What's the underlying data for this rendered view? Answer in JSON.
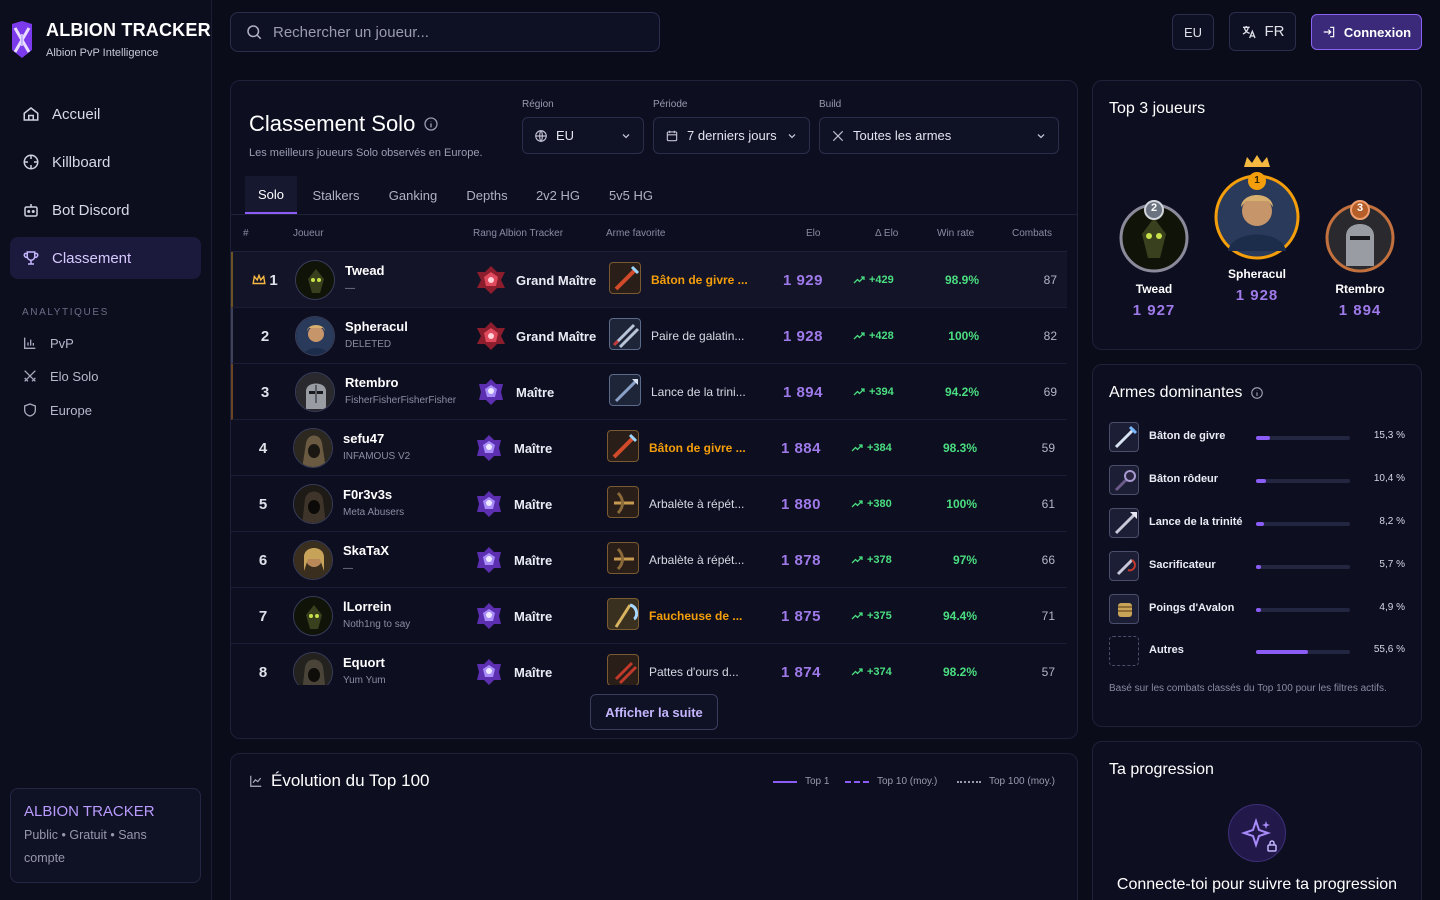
{
  "brand": {
    "title": "ALBION TRACKER",
    "subtitle": "Albion PvP Intelligence"
  },
  "nav": [
    {
      "label": "Accueil",
      "icon": "home-icon"
    },
    {
      "label": "Killboard",
      "icon": "crosshair-icon"
    },
    {
      "label": "Bot Discord",
      "icon": "bot-icon"
    },
    {
      "label": "Classement",
      "icon": "trophy-icon"
    }
  ],
  "analytics": {
    "title": "ANALYTIQUES",
    "items": [
      {
        "label": "PvP",
        "icon": "bar-chart-icon"
      },
      {
        "label": "Elo Solo",
        "icon": "swords-icon"
      },
      {
        "label": "Europe",
        "icon": "shield-icon"
      }
    ]
  },
  "side_card": {
    "title": "ALBION TRACKER",
    "text": "Public • Gratuit • Sans compte"
  },
  "search": {
    "placeholder": "Rechercher un joueur..."
  },
  "header": {
    "region": "EU",
    "lang": "FR",
    "login": "Connexion"
  },
  "leaderboard": {
    "title": "Classement Solo",
    "subtitle": "Les meilleurs joueurs Solo observés en Europe.",
    "filters": {
      "region_label": "Région",
      "region": "EU",
      "period_label": "Période",
      "period": "7 derniers jours",
      "build_label": "Build",
      "build": "Toutes les armes"
    },
    "tabs": [
      "Solo",
      "Stalkers",
      "Ganking",
      "Depths",
      "2v2 HG",
      "5v5 HG"
    ],
    "columns": {
      "rank": "#",
      "player": "Joueur",
      "tier": "Rang Albion Tracker",
      "weapon": "Arme favorite",
      "elo": "Elo",
      "delta": "Δ Elo",
      "winrate": "Win rate",
      "fights": "Combats"
    },
    "rows": [
      {
        "rank": "1",
        "name": "Twead",
        "guild": "—",
        "tier": "Grand Maître",
        "weapon": "Bâton de givre ...",
        "elo": "1 929",
        "delta": "+429",
        "winrate": "98.9%",
        "fights": "87"
      },
      {
        "rank": "2",
        "name": "Spheracul",
        "guild": "DELETED",
        "tier": "Grand Maître",
        "weapon": "Paire de galatin...",
        "elo": "1 928",
        "delta": "+428",
        "winrate": "100%",
        "fights": "82"
      },
      {
        "rank": "3",
        "name": "Rtembro",
        "guild": "FisherFisherFisherFisher",
        "tier": "Maître",
        "weapon": "Lance de la trini...",
        "elo": "1 894",
        "delta": "+394",
        "winrate": "94.2%",
        "fights": "69"
      },
      {
        "rank": "4",
        "name": "sefu47",
        "guild": "INFAMOUS V2",
        "tier": "Maître",
        "weapon": "Bâton de givre ...",
        "elo": "1 884",
        "delta": "+384",
        "winrate": "98.3%",
        "fights": "59"
      },
      {
        "rank": "5",
        "name": "F0r3v3s",
        "guild": "Meta Abusers",
        "tier": "Maître",
        "weapon": "Arbalète à répét...",
        "elo": "1 880",
        "delta": "+380",
        "winrate": "100%",
        "fights": "61"
      },
      {
        "rank": "6",
        "name": "SkaTaX",
        "guild": "—",
        "tier": "Maître",
        "weapon": "Arbalète à répét...",
        "elo": "1 878",
        "delta": "+378",
        "winrate": "97%",
        "fights": "66"
      },
      {
        "rank": "7",
        "name": "lLorrein",
        "guild": "Noth1ng to say",
        "tier": "Maître",
        "weapon": "Faucheuse de ...",
        "elo": "1 875",
        "delta": "+375",
        "winrate": "94.4%",
        "fights": "71"
      },
      {
        "rank": "8",
        "name": "Equort",
        "guild": "Yum Yum",
        "tier": "Maître",
        "weapon": "Pattes d'ours d...",
        "elo": "1 874",
        "delta": "+374",
        "winrate": "98.2%",
        "fights": "57"
      }
    ],
    "more": "Afficher la suite"
  },
  "evolution": {
    "title": "Évolution du Top 100",
    "legend": [
      "Top 1",
      "Top 10 (moy.)",
      "Top 100 (moy.)"
    ]
  },
  "top3": {
    "title": "Top 3 joueurs",
    "players": [
      {
        "place": "2",
        "name": "Twead",
        "elo": "1 927"
      },
      {
        "place": "1",
        "name": "Spheracul",
        "elo": "1 928"
      },
      {
        "place": "3",
        "name": "Rtembro",
        "elo": "1 894"
      }
    ]
  },
  "weapons": {
    "title": "Armes dominantes",
    "items": [
      {
        "name": "Bâton de givre",
        "pct": "15,3 %",
        "share": 0.153
      },
      {
        "name": "Bâton rôdeur",
        "pct": "10,4 %",
        "share": 0.104
      },
      {
        "name": "Lance de la trinité",
        "pct": "8,2 %",
        "share": 0.082
      },
      {
        "name": "Sacrificateur",
        "pct": "5,7 %",
        "share": 0.057
      },
      {
        "name": "Poings d'Avalon",
        "pct": "4,9 %",
        "share": 0.049
      },
      {
        "name": "Autres",
        "pct": "55,6 %",
        "share": 0.556
      }
    ],
    "note": "Basé sur les combats classés du Top 100 pour les filtres actifs."
  },
  "progress": {
    "title": "Ta progression",
    "cta": "Connecte-toi pour suivre ta progression"
  },
  "colors": {
    "accent": "#8b5cf6",
    "elo": "#9f7aea",
    "positive": "#4ade80",
    "gold": "#f59e0b",
    "bronze": "#c2703d",
    "silver": "#9ca3af"
  }
}
